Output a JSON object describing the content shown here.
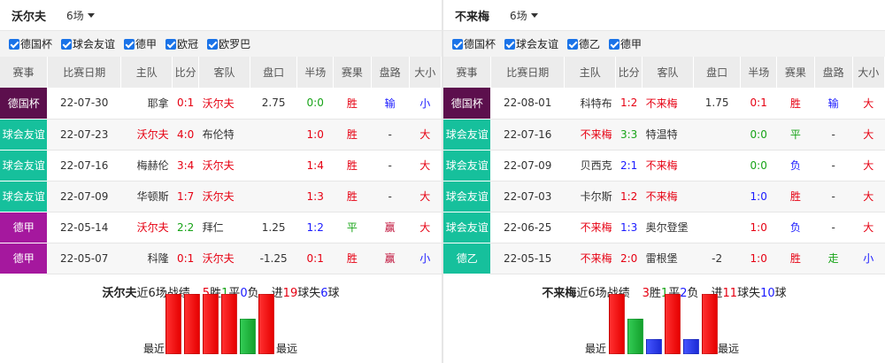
{
  "colors": {
    "德国杯": "#5c0f4d",
    "球会友谊": "#16c09c",
    "德甲": "#a5189e",
    "德乙": "#16c09c",
    "win": "#e60000",
    "draw": "#17a317",
    "loss": "#1a1aff"
  },
  "headers": [
    "赛事",
    "比赛日期",
    "主队",
    "比分",
    "客队",
    "盘口",
    "半场",
    "赛果",
    "盘路",
    "大小"
  ],
  "left": {
    "team": "沃尔夫",
    "count": "6场",
    "filters": [
      "德国杯",
      "球会友谊",
      "德甲",
      "欧冠",
      "欧罗巴"
    ],
    "rows": [
      {
        "league": "德国杯",
        "date": "22-07-30",
        "home": "耶拿",
        "score": "0:1",
        "away": "沃尔夫",
        "handicap": "2.75",
        "half": "0:0",
        "result": "胜",
        "line": "输",
        "ou": "小"
      },
      {
        "league": "球会友谊",
        "date": "22-07-23",
        "home": "沃尔夫",
        "score": "4:0",
        "away": "布伦特",
        "handicap": "",
        "half": "1:0",
        "result": "胜",
        "line": "-",
        "ou": "大"
      },
      {
        "league": "球会友谊",
        "date": "22-07-16",
        "home": "梅赫伦",
        "score": "3:4",
        "away": "沃尔夫",
        "handicap": "",
        "half": "1:4",
        "result": "胜",
        "line": "-",
        "ou": "大"
      },
      {
        "league": "球会友谊",
        "date": "22-07-09",
        "home": "华顿斯",
        "score": "1:7",
        "away": "沃尔夫",
        "handicap": "",
        "half": "1:3",
        "result": "胜",
        "line": "-",
        "ou": "大"
      },
      {
        "league": "德甲",
        "date": "22-05-14",
        "home": "沃尔夫",
        "score": "2:2",
        "away": "拜仁",
        "handicap": "1.25",
        "half": "1:2",
        "result": "平",
        "line": "赢",
        "ou": "大"
      },
      {
        "league": "德甲",
        "date": "22-05-07",
        "home": "科隆",
        "score": "0:1",
        "away": "沃尔夫",
        "handicap": "-1.25",
        "half": "0:1",
        "result": "胜",
        "line": "赢",
        "ou": "小"
      }
    ],
    "summary": {
      "team": "沃尔夫",
      "text": "近6场战绩",
      "w": "5",
      "w_label": "胜",
      "d": "1",
      "d_label": "平",
      "l": "0",
      "l_label": "负",
      "goals_pre": "进",
      "gf": "19",
      "goals_mid": "球失",
      "ga": "6",
      "goals_post": "球"
    },
    "recent_label": "最近",
    "far_label": "最远",
    "form": [
      "win",
      "win",
      "win",
      "win",
      "draw",
      "win"
    ]
  },
  "right": {
    "team": "不来梅",
    "count": "6场",
    "filters": [
      "德国杯",
      "球会友谊",
      "德乙",
      "德甲"
    ],
    "rows": [
      {
        "league": "德国杯",
        "date": "22-08-01",
        "home": "科特布",
        "score": "1:2",
        "away": "不来梅",
        "handicap": "1.75",
        "half": "0:1",
        "result": "胜",
        "line": "输",
        "ou": "大"
      },
      {
        "league": "球会友谊",
        "date": "22-07-16",
        "home": "不来梅",
        "score": "3:3",
        "away": "特温特",
        "handicap": "",
        "half": "0:0",
        "result": "平",
        "line": "-",
        "ou": "大"
      },
      {
        "league": "球会友谊",
        "date": "22-07-09",
        "home": "贝西克",
        "score": "2:1",
        "away": "不来梅",
        "handicap": "",
        "half": "0:0",
        "result": "负",
        "line": "-",
        "ou": "大"
      },
      {
        "league": "球会友谊",
        "date": "22-07-03",
        "home": "卡尔斯",
        "score": "1:2",
        "away": "不来梅",
        "handicap": "",
        "half": "1:0",
        "result": "胜",
        "line": "-",
        "ou": "大"
      },
      {
        "league": "球会友谊",
        "date": "22-06-25",
        "home": "不来梅",
        "score": "1:3",
        "away": "奥尔登堡",
        "handicap": "",
        "half": "1:0",
        "result": "负",
        "line": "-",
        "ou": "大"
      },
      {
        "league": "德乙",
        "date": "22-05-15",
        "home": "不来梅",
        "score": "2:0",
        "away": "雷根堡",
        "handicap": "-2",
        "half": "1:0",
        "result": "胜",
        "line": "走",
        "ou": "小"
      }
    ],
    "summary": {
      "team": "不来梅",
      "text": "近6场战绩",
      "w": "3",
      "w_label": "胜",
      "d": "1",
      "d_label": "平",
      "l": "2",
      "l_label": "负",
      "goals_pre": "进",
      "gf": "11",
      "goals_mid": "球失",
      "ga": "10",
      "goals_post": "球"
    },
    "recent_label": "最近",
    "far_label": "最远",
    "form": [
      "win",
      "draw",
      "loss",
      "win",
      "loss",
      "win"
    ]
  }
}
